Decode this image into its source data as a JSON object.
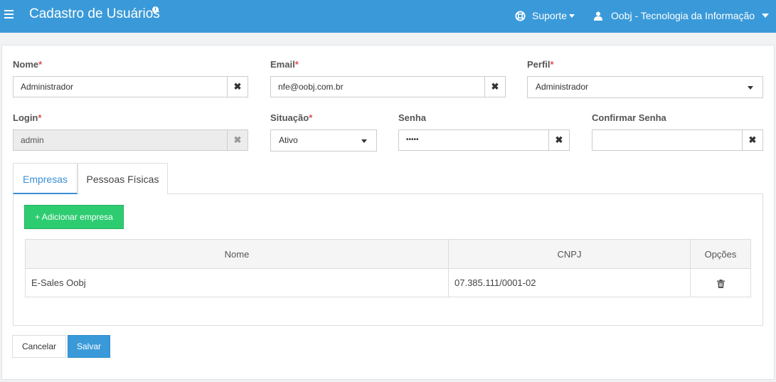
{
  "header": {
    "title": "Cadastro de Usuários",
    "support_label": "Suporte",
    "user_label": "Oobj - Tecnologia da Informação"
  },
  "form": {
    "nome": {
      "label": "Nome",
      "required": "*",
      "value": "Administrador"
    },
    "email": {
      "label": "Email",
      "required": "*",
      "value": "nfe@oobj.com.br"
    },
    "perfil": {
      "label": "Perfil",
      "required": "*",
      "value": "Administrador"
    },
    "login": {
      "label": "Login",
      "required": "*",
      "value": "admin"
    },
    "situacao": {
      "label": "Situação",
      "required": "*",
      "value": "Ativo"
    },
    "senha": {
      "label": "Senha",
      "value": "•••••"
    },
    "confirmar_senha": {
      "label": "Confirmar Senha",
      "value": ""
    },
    "clear_glyph": "✖"
  },
  "tabs": [
    {
      "label": "Empresas",
      "active": true
    },
    {
      "label": "Pessoas Físicas",
      "active": false
    }
  ],
  "empresas": {
    "add_button": "+ Adicionar empresa",
    "columns": [
      "Nome",
      "CNPJ",
      "Opções"
    ],
    "rows": [
      {
        "nome": "E-Sales Oobj",
        "cnpj": "07.385.111/0001-02"
      }
    ]
  },
  "actions": {
    "cancel": "Cancelar",
    "save": "Salvar"
  },
  "icons": {
    "menu": "hamburger-icon",
    "info": "info-icon",
    "support": "lifebuoy-icon",
    "user": "user-icon",
    "delete": "trash-icon"
  },
  "colors": {
    "topbar": "#3a9ad9",
    "add_button": "#2ecc71",
    "save_button": "#3a9ad9",
    "required": "#d9534f",
    "active_tab": "#3a8fd6"
  }
}
